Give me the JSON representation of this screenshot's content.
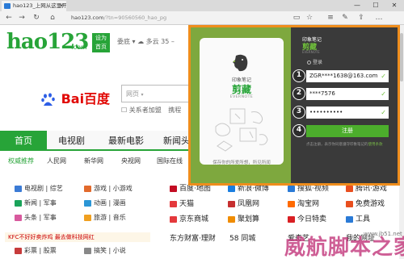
{
  "browser": {
    "tab_title": "hao123_上网从这里开始",
    "url_host": "hao123.com",
    "url_path": "/?tn=90560560_hao_pg",
    "back": "←",
    "forward": "→",
    "refresh": "↻",
    "home": "⌂",
    "reading": "▭",
    "favorite": "☆",
    "hub": "≡",
    "notes": "✎",
    "share": "⇪",
    "more": "…",
    "minimize": "—",
    "maximize": "☐",
    "close": "✕",
    "tab_close": "×"
  },
  "hao123": {
    "logo": "hao123",
    "logo_com": ".com",
    "set_home": [
      "设为",
      "首页"
    ],
    "topmenu": "委底 ▾     ☁ 多云 35 –"
  },
  "search": {
    "brand": "Bai百度",
    "tab": "网页",
    "caret": "▾",
    "checkbox_label": "关系者加盟",
    "extra": "携程"
  },
  "main_nav": [
    "首页",
    "电视剧",
    "最新电影",
    "新闻头"
  ],
  "sub_nav": [
    "权威推荐",
    "人民网",
    "新华网",
    "央视网",
    "国际在线"
  ],
  "categories": [
    {
      "icon_color": "#3b7bd5",
      "text": "电视剧 | 综艺"
    },
    {
      "icon_color": "#e26a2c",
      "text": "游戏 | 小游戏"
    },
    {
      "icon_color": "#1aa35a",
      "text": "新闻 | 军事"
    },
    {
      "icon_color": "#2b96d6",
      "text": "动画 | 漫画"
    },
    {
      "icon_color": "#d85a9e",
      "text": "头条 | 军事"
    },
    {
      "icon_color": "#f0a020",
      "text": "旅游 | 音乐"
    },
    {
      "icon_color": "#c73b3b",
      "text": "彩票 | 股票"
    },
    {
      "icon_color": "#888888",
      "text": "搞笑 | 小说"
    }
  ],
  "sites": [
    {
      "icon": "#c30d23",
      "text": "百度·地图"
    },
    {
      "icon": "#1a7ee0",
      "text": "新浪·微博"
    },
    {
      "icon": "#2a7ad6",
      "text": "搜狐·视频"
    },
    {
      "icon": "#e94f1f",
      "text": "腾讯·游戏"
    },
    {
      "icon": "#e4393c",
      "text": "天猫"
    },
    {
      "icon": "#c62f2f",
      "text": "凤凰网"
    },
    {
      "icon": "#ff6a00",
      "text": "淘宝网"
    },
    {
      "icon": "#e94f1f",
      "text": "免费游戏"
    },
    {
      "icon": "#e4393c",
      "text": "京东商城"
    },
    {
      "icon": "#f08c00",
      "text": "聚划算"
    },
    {
      "icon": "#d91f23",
      "text": "今日特卖"
    },
    {
      "icon": "#2a7ad6",
      "text": "工具"
    },
    {
      "icon": "#ffffff",
      "text": "东方财富·理财"
    },
    {
      "icon": "#ffffff",
      "text": "58 同城"
    },
    {
      "icon": "#ffffff",
      "text": "爱奇艺"
    },
    {
      "icon": "#ffffff",
      "text": "我的网址"
    }
  ],
  "ad": "KFC不好好卖炸鸡 最去做科技网红",
  "evernote": {
    "brand_small": "印象笔记",
    "brand_large": "剪藏",
    "brand_en": "EVERNOTE",
    "caption": "保存你的所爱所想，所见所闻",
    "panel_small": "印象笔记",
    "panel_large": "剪藏",
    "panel_en": "EVERNOTE",
    "login_label": "登录",
    "email_value": "ZGR****1638@163.com",
    "username_value": "****7576",
    "password_value": "••••••••••",
    "submit_label": "注册",
    "terms": "点击注册，表示你同意遵守印象笔记的",
    "terms_link": "使用条款",
    "check": "✓",
    "steps": [
      "1",
      "2",
      "3",
      "4"
    ]
  },
  "watermark": "威航脚本之家",
  "watermark_sub": "www.jb51.net",
  "colors": {
    "green": "#27a438",
    "orange_frame": "#ef8d1c",
    "evernote_green": "#7ea83e"
  }
}
